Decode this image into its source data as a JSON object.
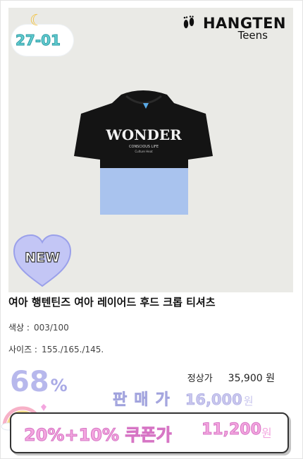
{
  "badge": {
    "code": "27-01",
    "moon_icon": "crescent-moon-icon"
  },
  "brand": {
    "name": "HANGTEN",
    "sub": "Teens",
    "logo_icon": "footprints-icon"
  },
  "new_badge": {
    "label": "NEW"
  },
  "shirt_print": {
    "main": "WONDER",
    "line1": "CONSCIOUS LIFE",
    "line2": "Culture Heat"
  },
  "product": {
    "title": "여아 행텐틴즈 여아 레이어드 후드 크롭 티셔츠",
    "color_label": "색상 :",
    "color_value": "003/100",
    "size_label": "사이즈 :",
    "size_value": "155./165./145."
  },
  "pricing": {
    "discount_value": "68",
    "discount_suffix": "%",
    "regular_label": "정상가",
    "regular_amount": "35,900 원",
    "sale_label": "판매가",
    "sale_amount": "16,000",
    "sale_unit": "원",
    "coupon_label": "20%+10% 쿠폰가",
    "coupon_amount": "11,200",
    "coupon_unit": "원"
  },
  "colors": {
    "accent_purple": "#b7b8ec",
    "coupon_pink": "#f3a6df",
    "image_bg": "#eaeae6"
  }
}
